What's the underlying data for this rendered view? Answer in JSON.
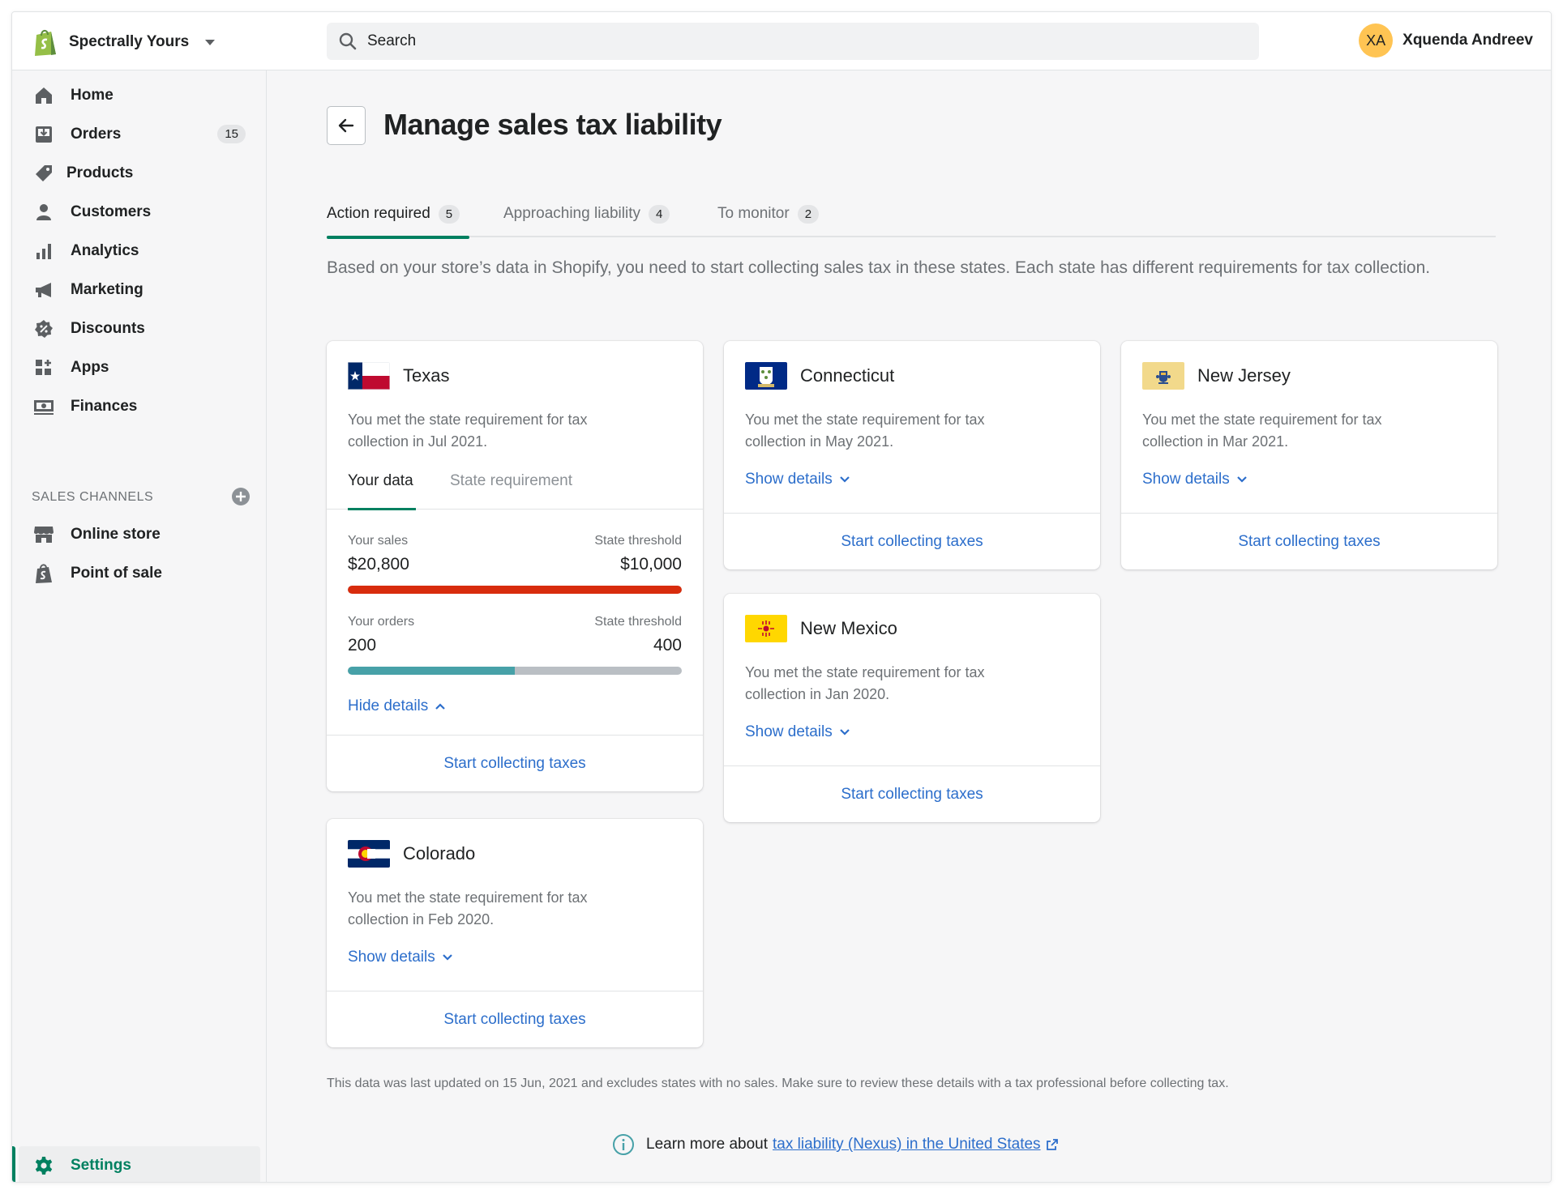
{
  "topbar": {
    "store_name": "Spectrally Yours",
    "search_placeholder": "Search",
    "user_initials": "XA",
    "user_name": "Xquenda Andreev"
  },
  "sidebar": {
    "items": [
      {
        "label": "Home",
        "icon": "home-icon"
      },
      {
        "label": "Orders",
        "icon": "orders-icon",
        "badge": "15"
      },
      {
        "label": "Products",
        "icon": "tag-icon"
      },
      {
        "label": "Customers",
        "icon": "person-icon"
      },
      {
        "label": "Analytics",
        "icon": "bar-chart-icon"
      },
      {
        "label": "Marketing",
        "icon": "megaphone-icon"
      },
      {
        "label": "Discounts",
        "icon": "discount-icon"
      },
      {
        "label": "Apps",
        "icon": "apps-icon"
      },
      {
        "label": "Finances",
        "icon": "banknote-icon"
      }
    ],
    "sales_channels_heading": "SALES CHANNELS",
    "channels": [
      {
        "label": "Online store",
        "icon": "store-icon"
      },
      {
        "label": "Point of sale",
        "icon": "shopping-bag-icon"
      }
    ],
    "settings_label": "Settings"
  },
  "page": {
    "title": "Manage sales tax liability",
    "tabs": [
      {
        "label": "Action required",
        "count": "5"
      },
      {
        "label": "Approaching liability",
        "count": "4"
      },
      {
        "label": "To monitor",
        "count": "2"
      }
    ],
    "intro": "Based on your store’s data in Shopify, you need to start collecting sales tax in these states. Each state has different requirements for tax collection.",
    "footnote": "This data was last updated on 15 Jun, 2021 and excludes states with no sales. Make sure to review these details with a tax professional before collecting tax.",
    "learn_prefix": "Learn more about",
    "learn_link": "tax liability (Nexus) in the United States"
  },
  "texas": {
    "name": "Texas",
    "desc": "You met the state requirement for tax collection in Jul 2021.",
    "tab_your_data": "Your data",
    "tab_state_req": "State requirement",
    "sales_label": "Your sales",
    "sales_value": "$20,800",
    "sales_threshold_label": "State threshold",
    "sales_threshold": "$10,000",
    "sales_progress": 1.0,
    "orders_label": "Your orders",
    "orders_value": "200",
    "orders_threshold_label": "State threshold",
    "orders_threshold": "400",
    "orders_progress": 0.5,
    "hide_details": "Hide details",
    "cta": "Start collecting taxes"
  },
  "cards": {
    "connecticut": {
      "name": "Connecticut",
      "desc": "You met the state requirement for tax collection in May 2021.",
      "show": "Show details",
      "cta": "Start collecting taxes"
    },
    "new_jersey": {
      "name": "New Jersey",
      "desc": "You met the state requirement for tax collection in Mar 2021.",
      "show": "Show details",
      "cta": "Start collecting taxes"
    },
    "new_mexico": {
      "name": "New Mexico",
      "desc": "You met the state requirement for tax collection in Jan 2020.",
      "show": "Show details",
      "cta": "Start collecting taxes"
    },
    "colorado": {
      "name": "Colorado",
      "desc": "You met the state requirement for tax collection in Feb 2020.",
      "show": "Show details",
      "cta": "Start collecting taxes"
    }
  },
  "colors": {
    "accent_green": "#008060",
    "link_blue": "#2c6ecb",
    "over_threshold_red": "#d82c0d",
    "progress_teal": "#47a1a8"
  }
}
